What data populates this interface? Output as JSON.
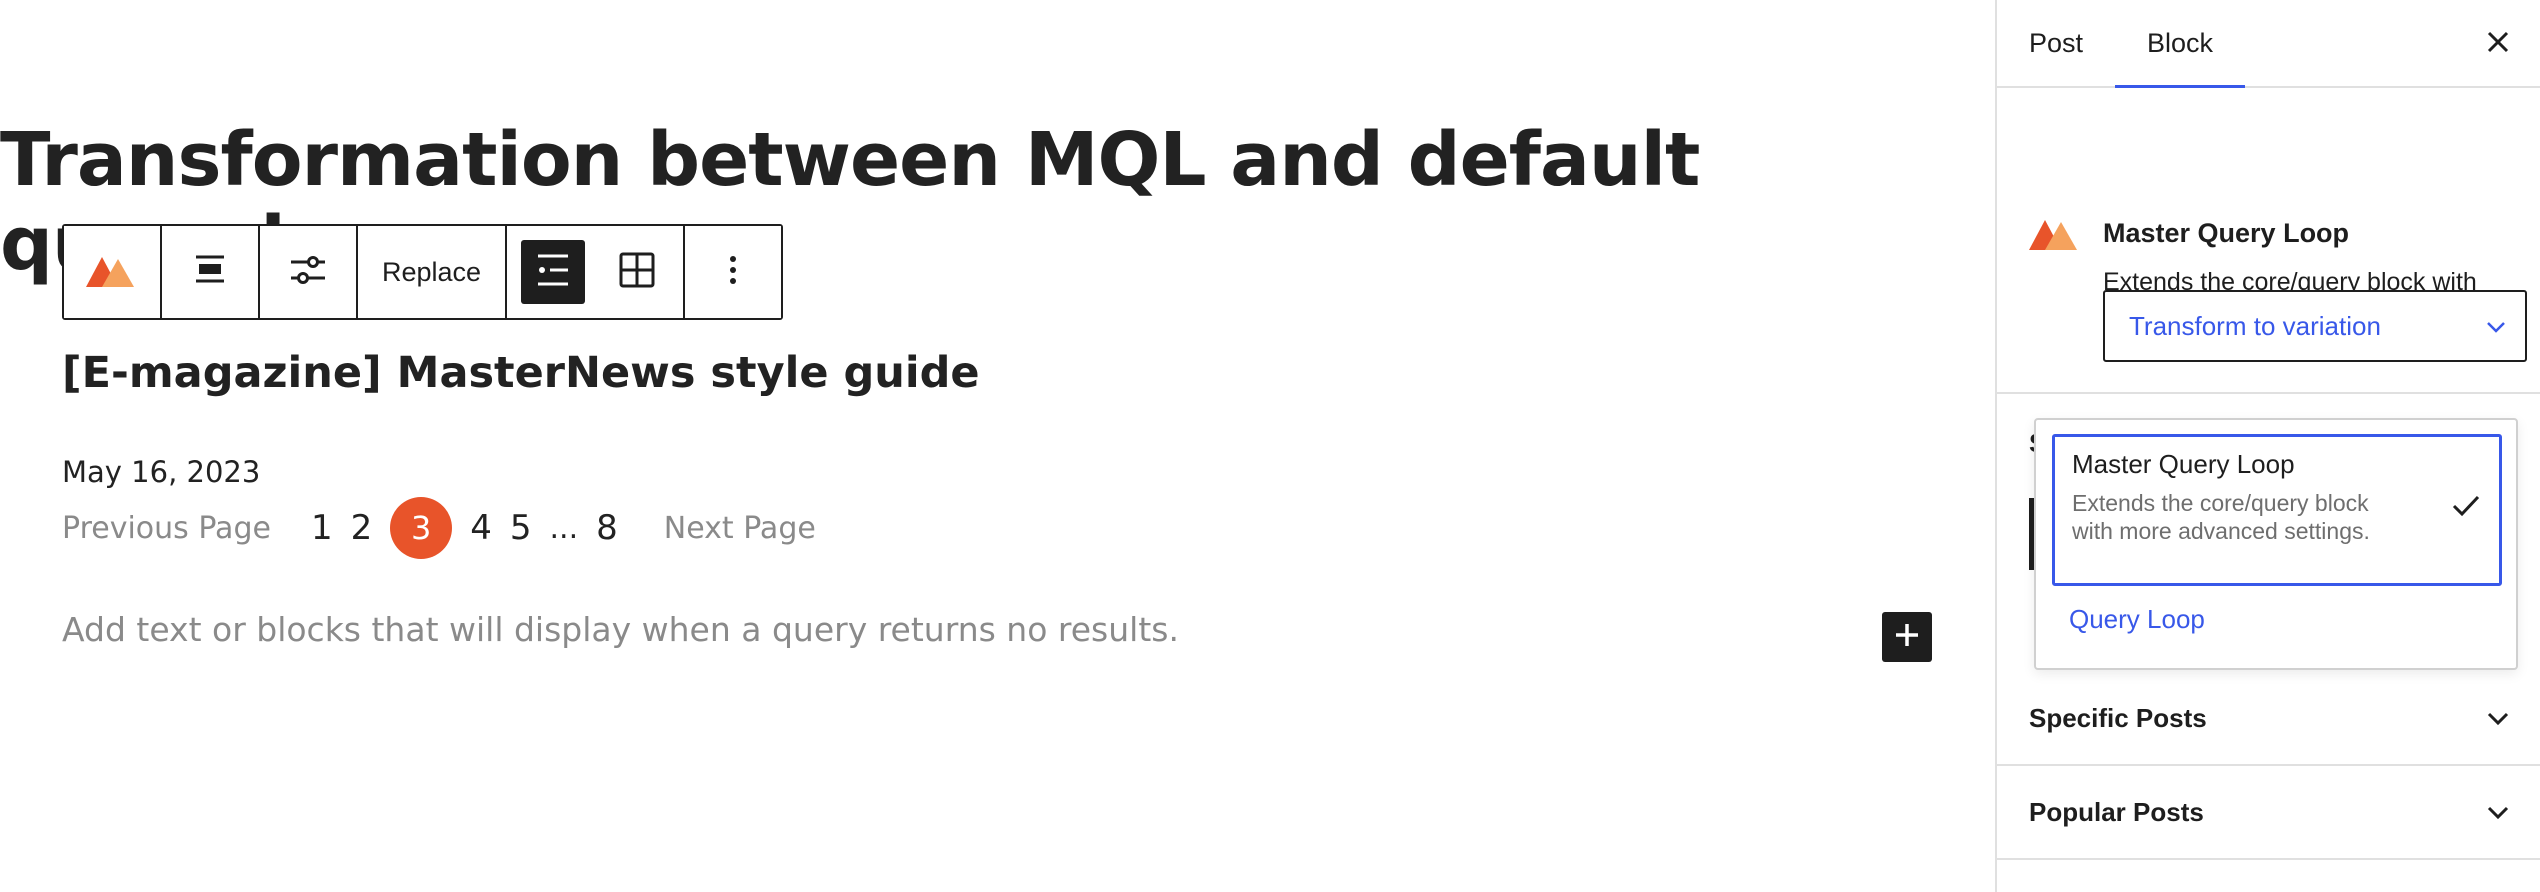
{
  "editor": {
    "post_title": "Transformation between MQL and default query loop",
    "toolbar": {
      "block_icon": "master-query-loop-icon",
      "align_icon": "align-justify-icon",
      "settings_icon": "sliders-icon",
      "replace_label": "Replace",
      "list_view_icon": "list-view-icon",
      "grid_view_icon": "grid-view-icon",
      "options_icon": "more-vertical-icon"
    },
    "post_link_title": "[E-magazine] MasterNews style guide",
    "post_date": "May 16, 2023",
    "pagination": {
      "previous_label": "Previous Page",
      "next_label": "Next Page",
      "pages": [
        "1",
        "2",
        "3",
        "4",
        "5",
        "...",
        "8"
      ],
      "current": "3",
      "current_color": "#e8542a"
    },
    "no_results_placeholder": "Add text or blocks that will display when a query returns no results.",
    "inserter_icon": "plus-icon"
  },
  "sidebar": {
    "tabs": [
      {
        "label": "Post",
        "active": false
      },
      {
        "label": "Block",
        "active": true
      }
    ],
    "close_icon": "close-icon",
    "accent_color": "#3858e9",
    "block_card": {
      "title": "Master Query Loop",
      "description": "Extends the core/query block with more advanced settings.",
      "transform_label": "Transform to variation"
    },
    "panels": [
      {
        "label": "Specific Posts"
      },
      {
        "label": "Popular Posts"
      }
    ]
  },
  "popover": {
    "options": [
      {
        "title": "Master Query Loop",
        "description": "Extends the core/query block with more advanced settings.",
        "selected": true
      },
      {
        "title": "Query Loop",
        "selected": false
      }
    ]
  }
}
